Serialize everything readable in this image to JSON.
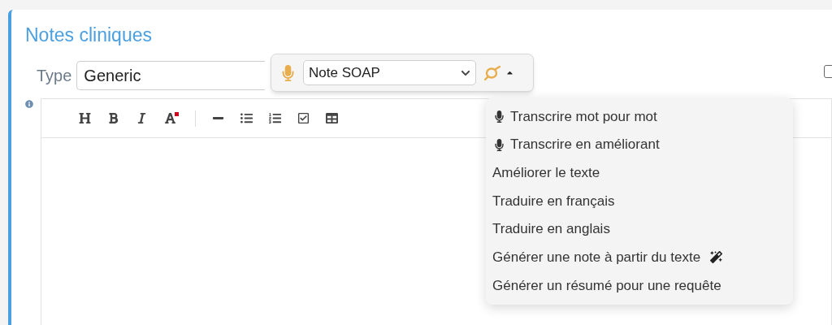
{
  "panel": {
    "title": "Notes cliniques"
  },
  "type_field": {
    "label": "Type",
    "value": "Generic"
  },
  "dictation_bar": {
    "template": "Note SOAP",
    "menu_expanded": true
  },
  "side_checkbox": {
    "checked": false
  },
  "menu": [
    {
      "kind": "dictation",
      "label": "Transcrire mot pour mot"
    },
    {
      "kind": "dictation",
      "label": "Transcrire en améliorant"
    },
    {
      "kind": "text",
      "label": "Améliorer le texte"
    },
    {
      "kind": "text",
      "label": "Traduire en français"
    },
    {
      "kind": "text",
      "label": "Traduire en anglais"
    },
    {
      "kind": "magic",
      "label": "Générer une note à partir du texte"
    },
    {
      "kind": "text",
      "label": "Générer un résumé pour une requête"
    }
  ]
}
